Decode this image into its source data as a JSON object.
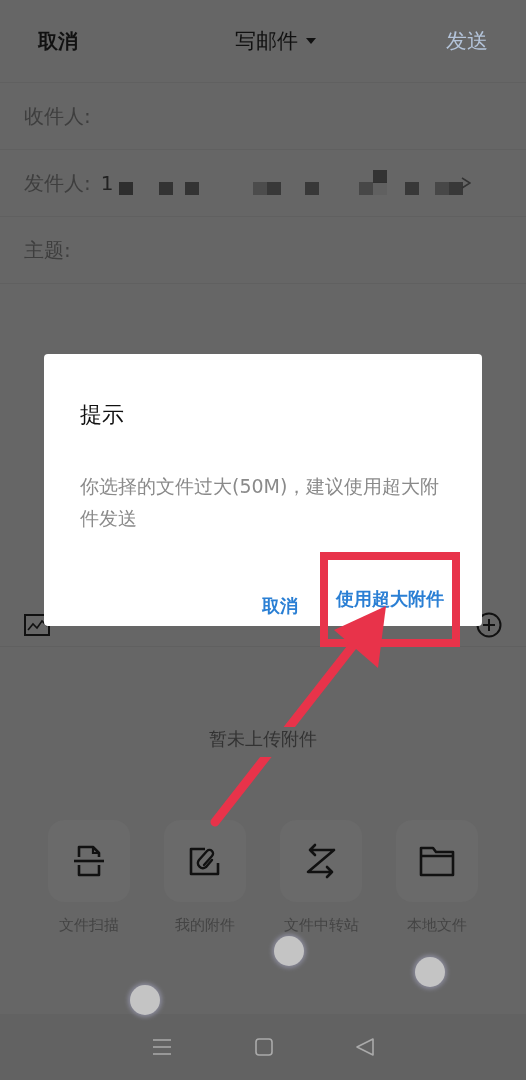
{
  "header": {
    "cancel": "取消",
    "title": "写邮件",
    "send": "发送"
  },
  "fields": [
    {
      "label": "收件人:",
      "kind": "plain"
    },
    {
      "label": "发件人:",
      "value": "1",
      "kind": "sender"
    },
    {
      "label": "主题:",
      "kind": "plain"
    }
  ],
  "attachments": {
    "empty_text": "暂未上传附件",
    "sources": [
      {
        "label": "文件扫描",
        "kind": "scan"
      },
      {
        "label": "我的附件",
        "kind": "attachment"
      },
      {
        "label": "文件中转站",
        "kind": "transfer"
      },
      {
        "label": "本地文件",
        "kind": "folder"
      }
    ]
  },
  "dialog": {
    "title": "提示",
    "message": "你选择的文件过大(50M)，建议使用超大附件发送",
    "buttons": [
      {
        "label": "取消",
        "annotated": false
      },
      {
        "label": "使用超大附件",
        "annotated": true
      }
    ]
  }
}
